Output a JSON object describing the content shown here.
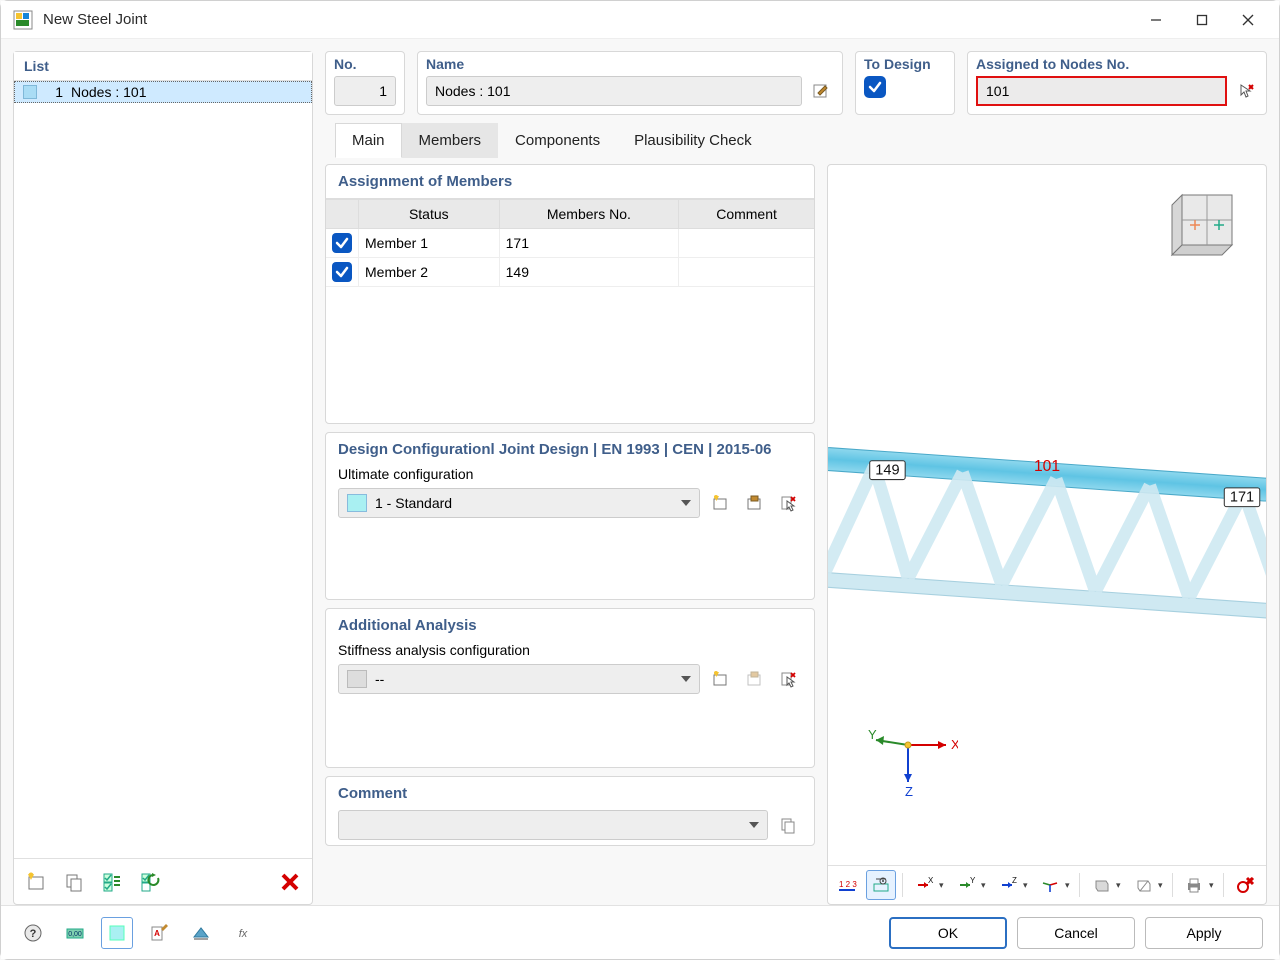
{
  "window": {
    "title": "New Steel Joint"
  },
  "list": {
    "header": "List",
    "items": [
      {
        "index": "1",
        "label": "Nodes : 101"
      }
    ]
  },
  "fields": {
    "no_label": "No.",
    "no_value": "1",
    "name_label": "Name",
    "name_value": "Nodes : 101",
    "to_design_label": "To Design",
    "assigned_label": "Assigned to Nodes No.",
    "assigned_value": "101"
  },
  "tabs": {
    "main": "Main",
    "members": "Members",
    "components": "Components",
    "plausibility": "Plausibility Check"
  },
  "sections": {
    "assign_members": {
      "title": "Assignment of Members",
      "cols": {
        "status": "Status",
        "members_no": "Members No.",
        "comment": "Comment"
      },
      "rows": [
        {
          "status": "Member 1",
          "number": "171",
          "comment": ""
        },
        {
          "status": "Member 2",
          "number": "149",
          "comment": ""
        }
      ]
    },
    "design_config": {
      "title": "Design Configurationl Joint Design | EN 1993 | CEN | 2015-06",
      "ultimate_label": "Ultimate configuration",
      "ultimate_value": "1 - Standard"
    },
    "additional": {
      "title": "Additional Analysis",
      "stiffness_label": "Stiffness analysis configuration",
      "stiffness_value": "--"
    },
    "comment": {
      "title": "Comment",
      "value": ""
    }
  },
  "preview": {
    "member_left": "149",
    "node": "101",
    "member_right": "171",
    "axes": {
      "x": "X",
      "y": "Y",
      "z": "Z"
    }
  },
  "buttons": {
    "ok": "OK",
    "cancel": "Cancel",
    "apply": "Apply"
  }
}
